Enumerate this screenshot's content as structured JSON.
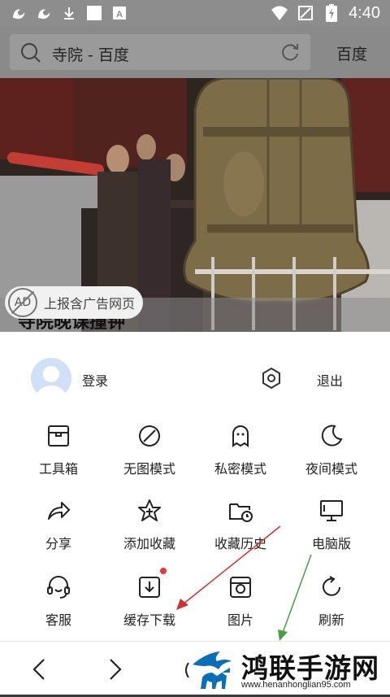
{
  "status_bar": {
    "time": "4:40",
    "icons": [
      "uc-browser-icon",
      "uc-browser-icon",
      "download-icon",
      "square-notification-icon",
      "a-notification-icon",
      "wifi-icon",
      "no-sim-icon",
      "battery-charging-icon"
    ]
  },
  "url_bar": {
    "query": "寺院 - 百度",
    "go_label": "百度"
  },
  "hero": {
    "headline": "寺院晚课撞钟",
    "ad_badge": "AD",
    "ad_report": "上报含广告网页"
  },
  "menu": {
    "login": "登录",
    "logout": "退出",
    "items": [
      {
        "label": "工具箱",
        "icon": "toolbox-icon"
      },
      {
        "label": "无图模式",
        "icon": "no-image-icon"
      },
      {
        "label": "私密模式",
        "icon": "ghost-icon"
      },
      {
        "label": "夜间模式",
        "icon": "moon-icon"
      },
      {
        "label": "分享",
        "icon": "share-icon"
      },
      {
        "label": "添加收藏",
        "icon": "star-add-icon"
      },
      {
        "label": "收藏历史",
        "icon": "folder-clock-icon"
      },
      {
        "label": "电脑版",
        "icon": "monitor-icon"
      },
      {
        "label": "客服",
        "icon": "headset-icon"
      },
      {
        "label": "缓存下载",
        "icon": "download-box-icon"
      },
      {
        "label": "图片",
        "icon": "image-icon"
      },
      {
        "label": "刷新",
        "icon": "refresh-icon"
      }
    ]
  },
  "watermark": {
    "title": "鸿联手游网",
    "url": "www.henanhonglian95.com"
  },
  "colors": {
    "overlay": "#8a8a8a",
    "red_dot": "#e53935",
    "arrow_red": "#d32f2f",
    "arrow_green": "#43a047"
  }
}
